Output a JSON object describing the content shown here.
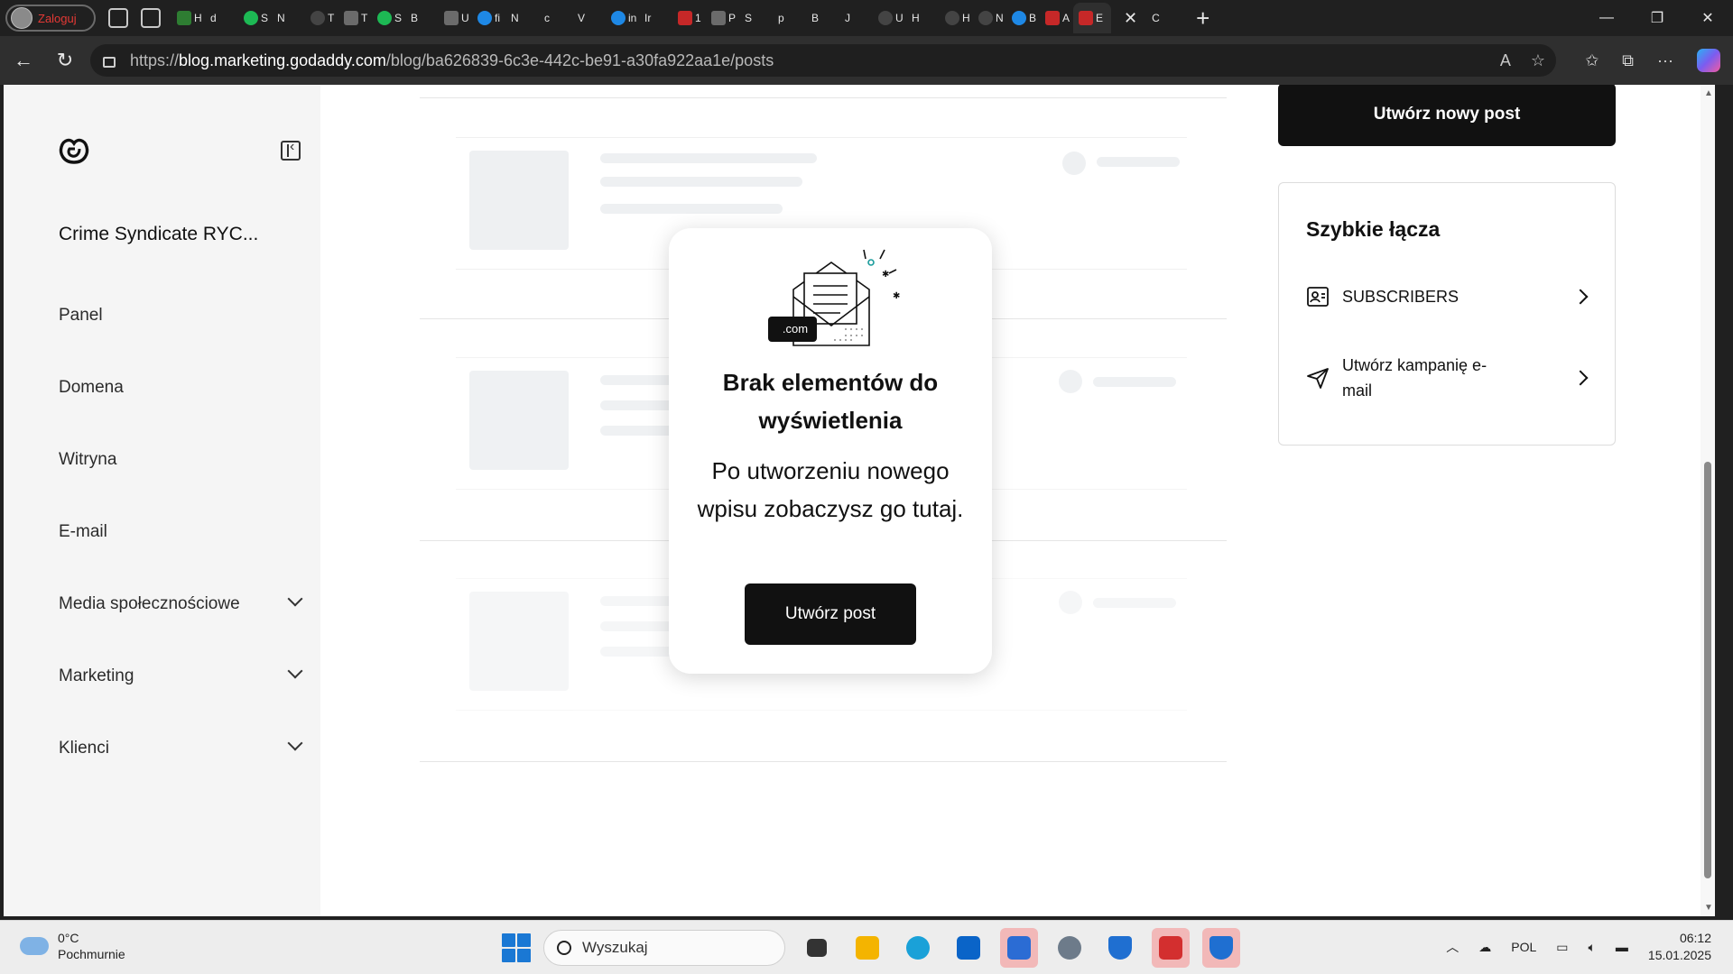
{
  "browser": {
    "profile_label": "Zaloguj",
    "tabs": [
      {
        "icon": "green-leaf-icon",
        "letter": "H"
      },
      {
        "icon": "page-icon",
        "letter": "d"
      },
      {
        "icon": "spotify-icon",
        "letter": "S"
      },
      {
        "icon": "page-icon",
        "letter": "N"
      },
      {
        "icon": "blank-icon",
        "letter": "T"
      },
      {
        "icon": "gray-icon",
        "letter": "T"
      },
      {
        "icon": "spotify-icon",
        "letter": "S"
      },
      {
        "icon": "page-icon",
        "letter": "B"
      },
      {
        "icon": "gear-icon",
        "letter": "U"
      },
      {
        "icon": "search-icon",
        "letter": "fi"
      },
      {
        "icon": "page-icon",
        "letter": "N"
      },
      {
        "icon": "page-icon",
        "letter": "c"
      },
      {
        "icon": "page-icon",
        "letter": "V"
      },
      {
        "icon": "search-icon",
        "letter": "in"
      },
      {
        "icon": "page-icon",
        "letter": "Ir"
      },
      {
        "icon": "pdf-icon",
        "letter": "1"
      },
      {
        "icon": "gray-icon",
        "letter": "P"
      },
      {
        "icon": "page-icon",
        "letter": "S"
      },
      {
        "icon": "page-icon",
        "letter": "p"
      },
      {
        "icon": "page-icon",
        "letter": "B"
      },
      {
        "icon": "page-icon",
        "letter": "J"
      },
      {
        "icon": "github-icon",
        "letter": "U"
      },
      {
        "icon": "page-icon",
        "letter": "H"
      },
      {
        "icon": "blank-icon",
        "letter": "H"
      },
      {
        "icon": "github-icon",
        "letter": "N"
      },
      {
        "icon": "figma-icon",
        "letter": "B"
      },
      {
        "icon": "adobe-icon",
        "letter": "A"
      }
    ],
    "active_tab_letter": "E",
    "trailing_tab_letter": "C",
    "url_prefix": "https://",
    "url_host": "blog.marketing.godaddy.com",
    "url_path": "/blog/ba626839-6c3e-442c-be91-a30fa922aa1e/posts"
  },
  "sidebar": {
    "site_name": "Crime Syndicate RYC...",
    "items": [
      {
        "label": "Panel",
        "expandable": false
      },
      {
        "label": "Domena",
        "expandable": false
      },
      {
        "label": "Witryna",
        "expandable": false
      },
      {
        "label": "E-mail",
        "expandable": false
      },
      {
        "label": "Media społecznościowe",
        "expandable": true
      },
      {
        "label": "Marketing",
        "expandable": true
      },
      {
        "label": "Klienci",
        "expandable": true
      }
    ]
  },
  "empty_state": {
    "badge": ".com",
    "title": "Brak elementów do wyświetlenia",
    "description": "Po utworzeniu nowego wpisu zobaczysz go tutaj.",
    "button": "Utwórz post"
  },
  "right_panel": {
    "create_button": "Utwórz nowy post",
    "quick_links_title": "Szybkie łącza",
    "links": [
      {
        "label": "SUBSCRIBERS",
        "icon": "subscribers-icon"
      },
      {
        "label": "Utwórz kampanię e-mail",
        "icon": "send-icon"
      }
    ]
  },
  "taskbar": {
    "temperature": "0°C",
    "weather": "Pochmurnie",
    "search_placeholder": "Wyszukaj",
    "language": "POL",
    "time": "06:12",
    "date": "15.01.2025"
  },
  "colors": {
    "primary": "#111111",
    "sidebar_bg": "#f5f5f5",
    "skeleton": "#eef0f2"
  }
}
